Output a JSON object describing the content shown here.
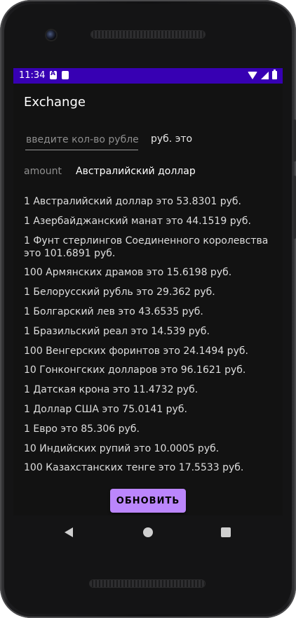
{
  "status_bar": {
    "time": "11:34",
    "icons_left": [
      "a-notification-icon",
      "sd-card-icon"
    ],
    "icons_right": [
      "wifi-icon",
      "signal-icon",
      "battery-icon"
    ],
    "color": "#3700b3"
  },
  "app": {
    "title": "Exchange"
  },
  "form": {
    "amount_placeholder": "введите кол-во рублей",
    "rub_label": "руб. это",
    "amount_label": "amount",
    "selected_currency": "Австралийский доллар"
  },
  "rates": [
    "1 Австралийский доллар это 53.8301 руб.",
    "1 Азербайджанский манат это 44.1519 руб.",
    "1 Фунт стерлингов Соединенного королевства это 101.6891 руб.",
    "100 Армянских драмов это 15.6198 руб.",
    "1 Белорусский рубль это 29.362 руб.",
    "1 Болгарский лев это 43.6535 руб.",
    "1 Бразильский реал это 14.539 руб.",
    "100 Венгерских форинтов это 24.1494 руб.",
    "10 Гонконгских долларов это 96.1621 руб.",
    "1 Датская крона это 11.4732 руб.",
    "1 Доллар США это 75.0141 руб.",
    "1 Евро это 85.306 руб.",
    "10 Индийских рупий это 10.0005 руб.",
    "100 Казахстанских тенге это 17.5533 руб."
  ],
  "actions": {
    "update_label": "ОБНОВИТЬ",
    "accent": "#bb86fc"
  },
  "nav_bar": {
    "icons": [
      "back-icon",
      "home-icon",
      "recents-icon"
    ]
  }
}
